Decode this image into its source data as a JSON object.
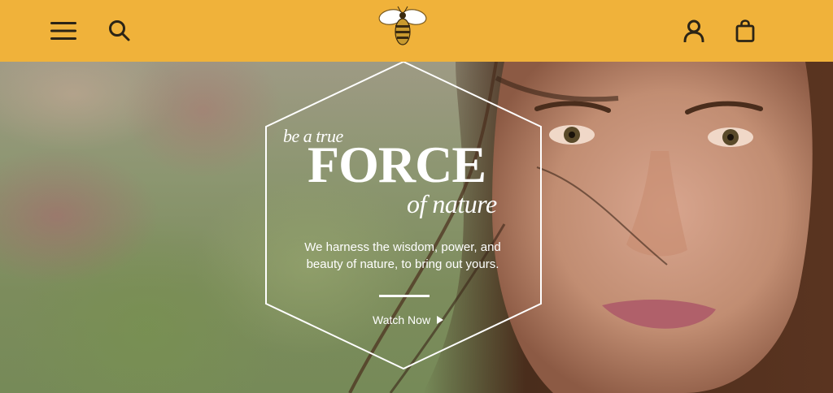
{
  "header": {
    "background_color": "#f0b23a",
    "menu_icon": "hamburger-menu-icon",
    "search_icon": "search-icon",
    "logo_icon": "bee-logo",
    "account_icon": "user-account-icon",
    "bag_icon": "shopping-bag-icon"
  },
  "hero": {
    "tagline_small": "be a true",
    "tagline_big": "FORCE",
    "tagline_tail": "of nature",
    "copy_line1": "We harness the wisdom, power, and",
    "copy_line2": "beauty of nature, to bring out yours.",
    "cta_label": "Watch Now",
    "cta_icon": "play-triangle-icon"
  }
}
